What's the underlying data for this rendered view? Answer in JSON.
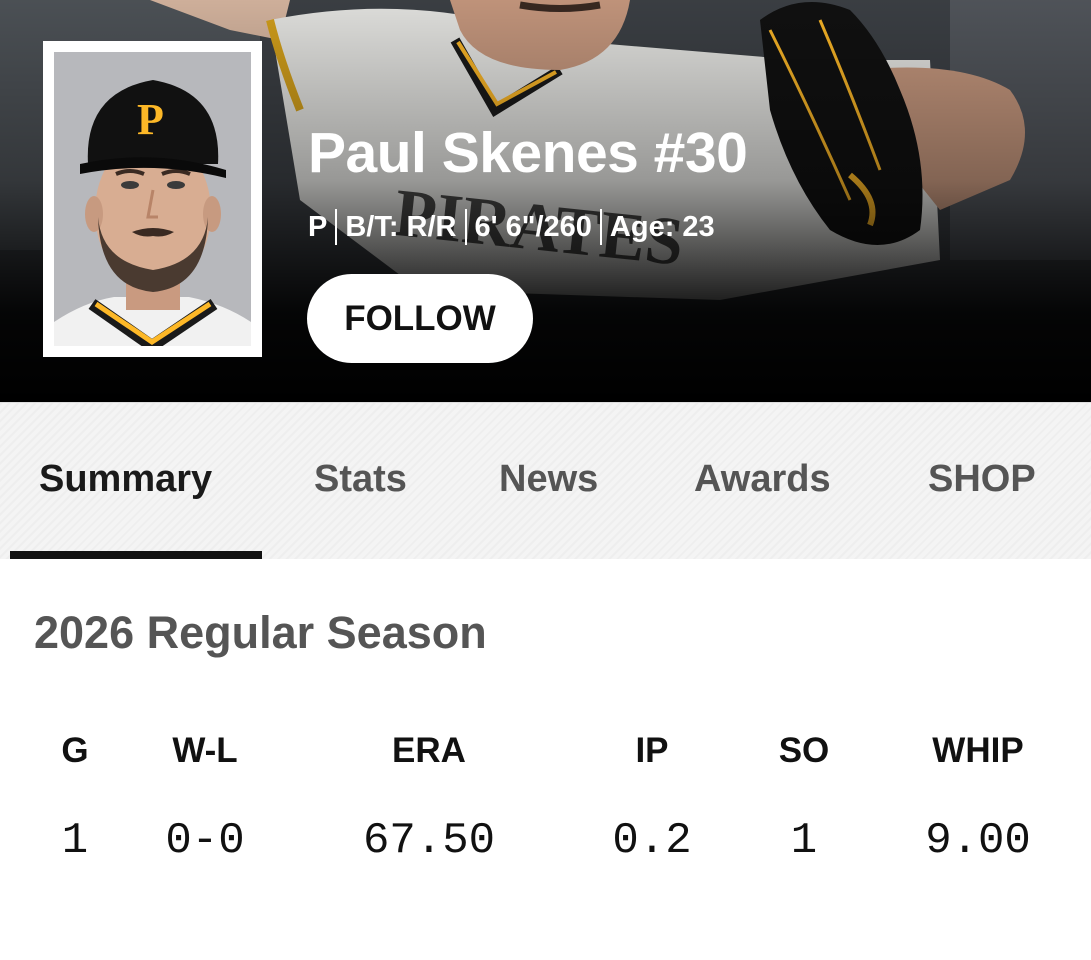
{
  "player": {
    "name": "Paul Skenes #30",
    "bio": [
      "P",
      "B/T: R/R",
      "6' 6\"/260",
      "Age: 23"
    ],
    "follow_label": "FOLLOW",
    "team_cap_letter": "P"
  },
  "colors": {
    "hero_bg": "#000000",
    "team_gold": "#FDB827",
    "tab_active": "#1a1a1a",
    "tab_inactive": "#555555"
  },
  "tabs": [
    {
      "label": "Summary",
      "active": true
    },
    {
      "label": "Stats",
      "active": false
    },
    {
      "label": "News",
      "active": false
    },
    {
      "label": "Awards",
      "active": false
    },
    {
      "label": "SHOP",
      "active": false
    }
  ],
  "season": {
    "title": "2026 Regular Season",
    "headers": [
      "G",
      "W-L",
      "ERA",
      "IP",
      "SO",
      "WHIP"
    ],
    "values": [
      "1",
      "0-0",
      "67.50",
      "0.2",
      "1",
      "9.00"
    ]
  }
}
